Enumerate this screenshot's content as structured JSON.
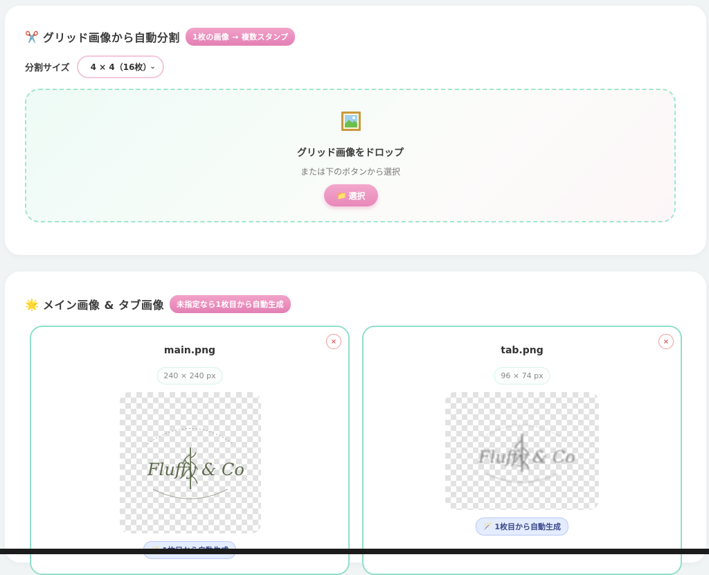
{
  "grid_section": {
    "icon": "✂️",
    "title": "グリッド画像から自動分割",
    "badge": "1枚の画像 → 複数スタンプ",
    "size_label": "分割サイズ",
    "size_value": "4 × 4（16枚）",
    "drop_title": "グリッド画像をドロップ",
    "drop_sub": "または下のボタンから選択",
    "select_button_icon": "📁",
    "select_button": "選択"
  },
  "main_tab_section": {
    "icon": "🌟",
    "title": "メイン画像 & タブ画像",
    "badge": "未指定なら1枚目から自動生成",
    "main": {
      "filename": "main.png",
      "dimensions": "240 × 240 px",
      "auto_label": "1枚目から自動生成",
      "logo_text": "Fluffy & Co",
      "close": "×"
    },
    "tab": {
      "filename": "tab.png",
      "dimensions": "96 × 74 px",
      "auto_label": "1枚目から自動生成",
      "logo_text": "Fluffy & Co",
      "close": "×"
    }
  },
  "colors": {
    "accent_pink": "#e37fb4",
    "accent_mint": "#8fe0c9",
    "badge_blue": "#e4ecff"
  }
}
